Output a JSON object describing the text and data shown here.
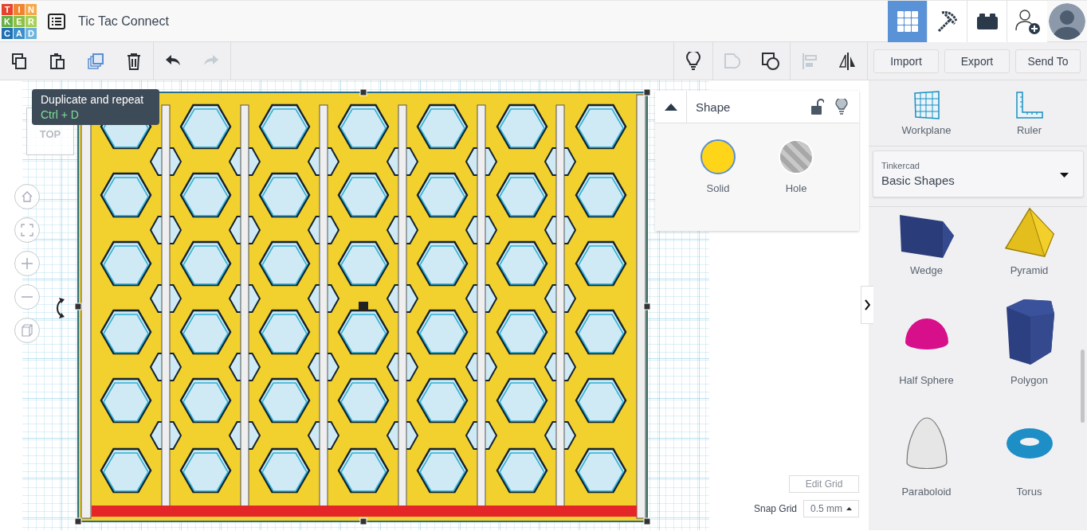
{
  "logo": [
    {
      "letter": "T",
      "color": "#e5432d"
    },
    {
      "letter": "I",
      "color": "#f0842f"
    },
    {
      "letter": "N",
      "color": "#f5a94a"
    },
    {
      "letter": "K",
      "color": "#68b045"
    },
    {
      "letter": "E",
      "color": "#8cc146"
    },
    {
      "letter": "R",
      "color": "#a9cf55"
    },
    {
      "letter": "C",
      "color": "#1f6fb2"
    },
    {
      "letter": "A",
      "color": "#3b8fca"
    },
    {
      "letter": "D",
      "color": "#6db3de"
    }
  ],
  "title": "Tic Tac Connect",
  "view_modes": [
    {
      "kind": "grid",
      "selected": true
    },
    {
      "kind": "pickaxe",
      "selected": false
    },
    {
      "kind": "brick",
      "selected": false
    }
  ],
  "toolbar": [
    {
      "kind": "copy",
      "disabled": false,
      "highlighted": false
    },
    {
      "kind": "paste",
      "disabled": false,
      "highlighted": false
    },
    {
      "kind": "duplicate",
      "disabled": false,
      "highlighted": true
    },
    {
      "kind": "delete",
      "disabled": false,
      "highlighted": false
    },
    {
      "kind": "undo",
      "disabled": false,
      "highlighted": false
    },
    {
      "kind": "redo",
      "disabled": true,
      "highlighted": false
    }
  ],
  "shape_tools": [
    {
      "kind": "bulb",
      "disabled": false
    },
    {
      "kind": "group",
      "disabled": true
    },
    {
      "kind": "ungroup",
      "disabled": false
    },
    {
      "kind": "align",
      "disabled": true
    },
    {
      "kind": "mirror",
      "disabled": false
    }
  ],
  "actions": [
    "Import",
    "Export",
    "Send To"
  ],
  "tooltip": {
    "text": "Duplicate and repeat",
    "shortcut": "Ctrl + D"
  },
  "view_cube": "TOP",
  "shape_panel": {
    "title": "Shape",
    "options": [
      {
        "label": "Solid",
        "kind": "solid",
        "selected": true
      },
      {
        "label": "Hole",
        "kind": "hole",
        "selected": false
      }
    ]
  },
  "edit_grid": "Edit Grid",
  "snap_grid": {
    "label": "Snap Grid",
    "value": "0.5 mm"
  },
  "tools": [
    {
      "kind": "workplane",
      "label": "Workplane"
    },
    {
      "kind": "ruler",
      "label": "Ruler"
    }
  ],
  "library": {
    "source": "Tinkercad",
    "category": "Basic Shapes"
  },
  "shapes": [
    {
      "kind": "wedge",
      "label": "Wedge"
    },
    {
      "kind": "pyramid",
      "label": "Pyramid"
    },
    {
      "kind": "half_sphere",
      "label": "Half Sphere"
    },
    {
      "kind": "polygon",
      "label": "Polygon"
    },
    {
      "kind": "paraboloid",
      "label": "Paraboloid"
    },
    {
      "kind": "torus",
      "label": "Torus"
    }
  ]
}
